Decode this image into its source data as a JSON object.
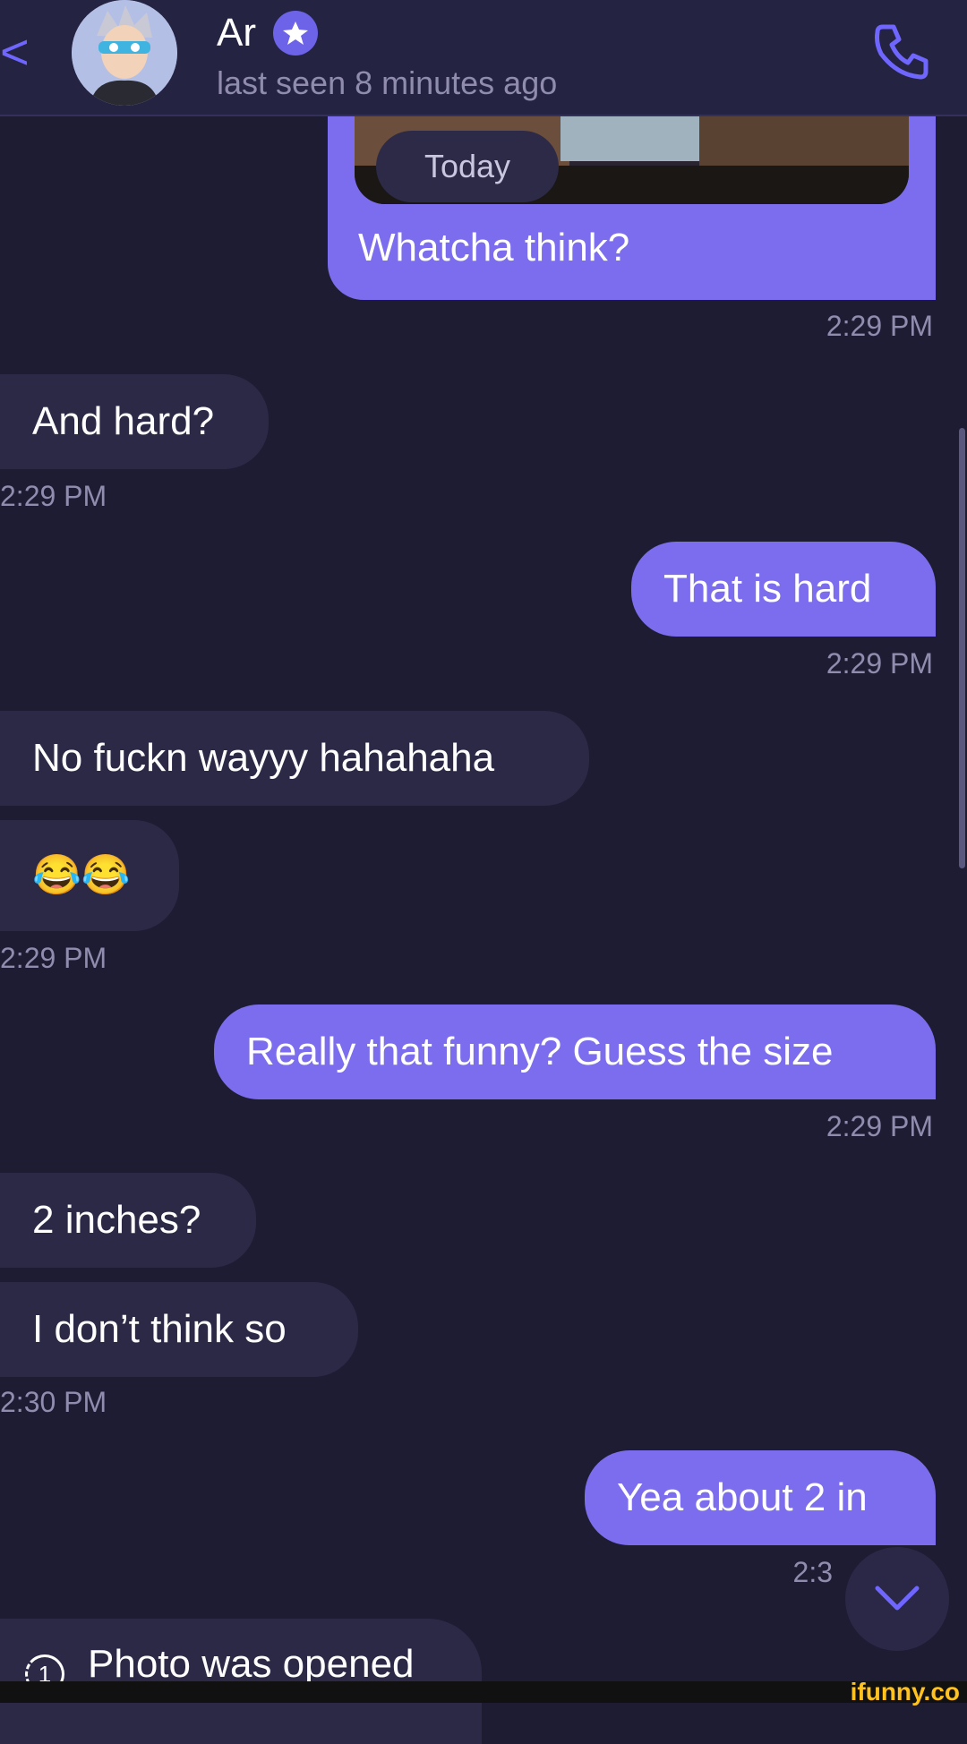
{
  "header": {
    "back_glyph": "<",
    "contact_name": "Ar",
    "last_seen": "last seen 8 minutes ago"
  },
  "date_divider": "Today",
  "messages": [
    {
      "dir": "out",
      "text": "Whatcha think?",
      "time": "2:29 PM",
      "has_photo": true
    },
    {
      "dir": "in",
      "text": "And hard?",
      "time": "2:29 PM"
    },
    {
      "dir": "out",
      "text": "That is hard",
      "time": "2:29 PM"
    },
    {
      "dir": "in",
      "text": "No fuckn wayyy hahahaha"
    },
    {
      "dir": "in",
      "text": "😂😂",
      "time": "2:29 PM"
    },
    {
      "dir": "out",
      "text": "Really that funny? Guess the size",
      "time": "2:29 PM"
    },
    {
      "dir": "in",
      "text": "2 inches?"
    },
    {
      "dir": "in",
      "text": "I don’t think so",
      "time": "2:30 PM"
    },
    {
      "dir": "out",
      "text": "Yea about 2 in",
      "time": "2:3"
    }
  ],
  "system": {
    "photo_opened": "Photo was opened",
    "info_glyph": "1"
  },
  "watermark": "ifunny.co",
  "colors": {
    "background": "#1e1c33",
    "outgoing_bubble": "#7b6ded",
    "incoming_bubble": "#2b2946",
    "accent": "#6f66ff",
    "muted_text": "#8f8cae"
  },
  "icons": [
    "back-chevron-icon",
    "verified-star-icon",
    "phone-icon",
    "chevron-down-icon",
    "info-icon"
  ]
}
